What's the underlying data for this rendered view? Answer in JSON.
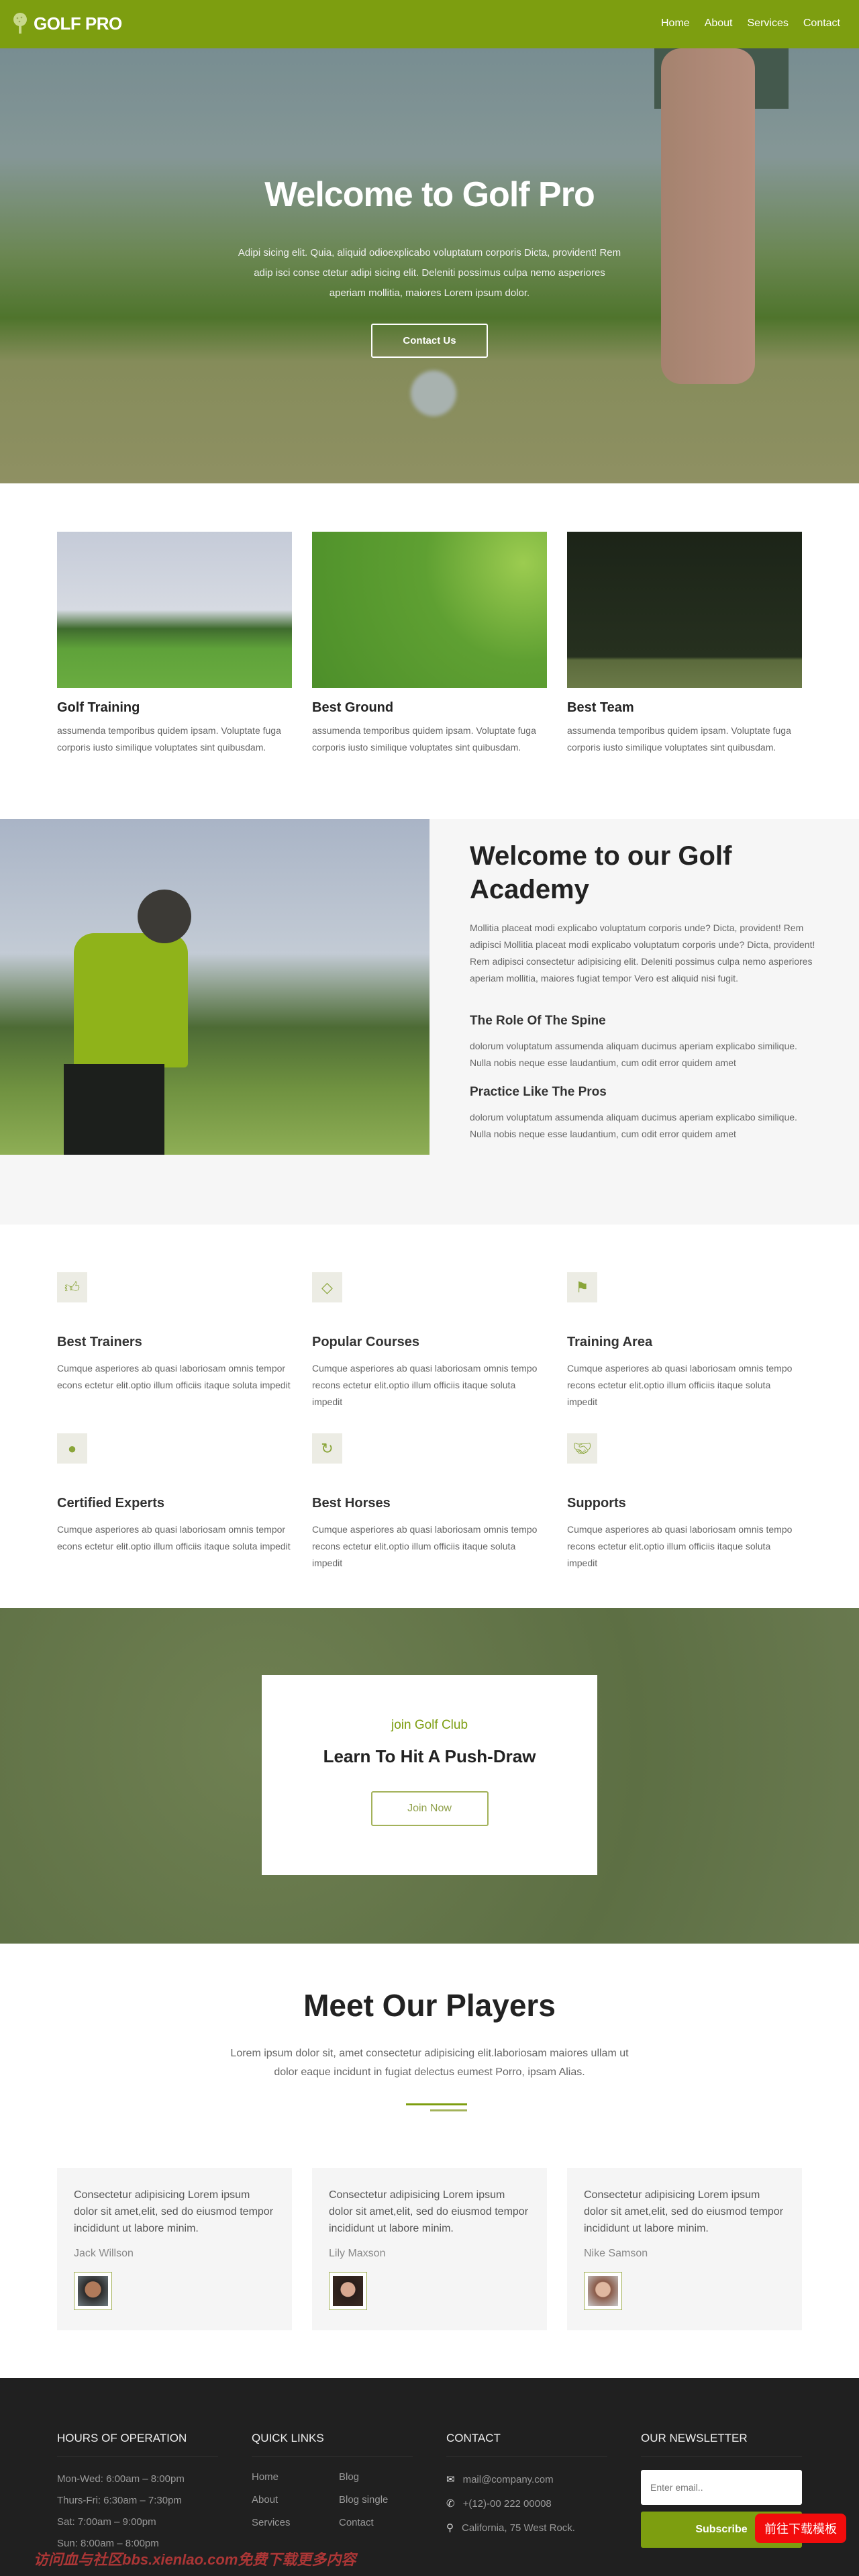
{
  "brand": {
    "name": "GOLF PRO",
    "accent": "#7d9e10"
  },
  "nav": {
    "items": [
      "Home",
      "About",
      "Services",
      "Contact"
    ]
  },
  "hero": {
    "title": "Welcome to Golf Pro",
    "text": "Adipi sicing elit. Quia, aliquid odioexplicabo voluptatum corporis Dicta, provident! Rem adip isci conse ctetur adipi sicing elit. Deleniti possimus culpa nemo asperiores aperiam mollitia, maiores Lorem ipsum dolor.",
    "button": "Contact Us"
  },
  "cards": [
    {
      "title": "Golf Training",
      "text": "assumenda temporibus quidem ipsam. Voluptate fuga corporis iusto similique voluptates sint quibusdam."
    },
    {
      "title": "Best Ground",
      "text": "assumenda temporibus quidem ipsam. Voluptate fuga corporis iusto similique voluptates sint quibusdam."
    },
    {
      "title": "Best Team",
      "text": "assumenda temporibus quidem ipsam. Voluptate fuga corporis iusto similique voluptates sint quibusdam."
    }
  ],
  "academy": {
    "title": "Welcome to our Golf Academy",
    "text": "Mollitia placeat modi explicabo voluptatum corporis unde? Dicta, provident! Rem adipisci Mollitia placeat modi explicabo voluptatum corporis unde? Dicta, provident! Rem adipisci consectetur adipisicing elit. Deleniti possimus culpa nemo asperiores aperiam mollitia, maiores fugiat tempor Vero est aliquid nisi fugit.",
    "sections": [
      {
        "title": "The Role Of The Spine",
        "text": "dolorum voluptatum assumenda aliquam ducimus aperiam explicabo similique. Nulla nobis neque esse laudantium, cum odit error quidem amet"
      },
      {
        "title": "Practice Like The Pros",
        "text": "dolorum voluptatum assumenda aliquam ducimus aperiam explicabo similique. Nulla nobis neque esse laudantium, cum odit error quidem amet"
      }
    ]
  },
  "features": [
    {
      "icon": "thumbs-up",
      "title": "Best Trainers",
      "text": "Cumque asperiores ab quasi laboriosam omnis tempor econs ectetur elit.optio illum officiis itaque soluta impedit"
    },
    {
      "icon": "diamond",
      "title": "Popular Courses",
      "text": "Cumque asperiores ab quasi laboriosam omnis tempo recons ectetur elit.optio illum officiis itaque soluta impedit"
    },
    {
      "icon": "flag",
      "title": "Training Area",
      "text": "Cumque asperiores ab quasi laboriosam omnis tempo recons ectetur elit.optio illum officiis itaque soluta impedit"
    },
    {
      "icon": "user",
      "title": "Certified Experts",
      "text": "Cumque asperiores ab quasi laboriosam omnis tempor econs ectetur elit.optio illum officiis itaque soluta impedit"
    },
    {
      "icon": "refresh",
      "title": "Best Horses",
      "text": "Cumque asperiores ab quasi laboriosam omnis tempo recons ectetur elit.optio illum officiis itaque soluta impedit"
    },
    {
      "icon": "handshake",
      "title": "Supports",
      "text": "Cumque asperiores ab quasi laboriosam omnis tempo recons ectetur elit.optio illum officiis itaque soluta impedit"
    }
  ],
  "cta": {
    "subtitle": "join Golf Club",
    "title": "Learn To Hit A Push-Draw",
    "button": "Join Now"
  },
  "players": {
    "title": "Meet Our Players",
    "text": "Lorem ipsum dolor sit, amet consectetur adipisicing elit.laboriosam maiores ullam ut dolor eaque incidunt in fugiat delectus eumest Porro, ipsam Alias.",
    "items": [
      {
        "quote": "Consectetur adipisicing Lorem ipsum dolor sit amet,elit, sed do eiusmod tempor incididunt ut labore minim.",
        "name": "Jack Willson"
      },
      {
        "quote": "Consectetur adipisicing Lorem ipsum dolor sit amet,elit, sed do eiusmod tempor incididunt ut labore minim.",
        "name": "Lily Maxson"
      },
      {
        "quote": "Consectetur adipisicing Lorem ipsum dolor sit amet,elit, sed do eiusmod tempor incididunt ut labore minim.",
        "name": "Nike Samson"
      }
    ]
  },
  "footer": {
    "hours": {
      "title": "HOURS OF OPERATION",
      "items": [
        "Mon-Wed: 6:00am – 8:00pm",
        "Thurs-Fri: 6:30am – 7:30pm",
        "Sat: 7:00am – 9:00pm",
        "Sun: 8:00am – 8:00pm"
      ]
    },
    "links": {
      "title": "QUICK LINKS",
      "items": [
        "Home",
        "Blog",
        "About",
        "Blog single",
        "Services",
        "Contact"
      ]
    },
    "contact": {
      "title": "CONTACT",
      "email": "mail@company.com",
      "phone": "+(12)-00 222 00008",
      "address": "California, 75 West Rock."
    },
    "newsletter": {
      "title": "OUR NEWSLETTER",
      "placeholder": "Enter email..",
      "button": "Subscribe"
    }
  },
  "overlay": {
    "download_button": "前往下载模板",
    "watermark": "访问血与社区bbs.xienlao.com免费下载更多内容"
  }
}
